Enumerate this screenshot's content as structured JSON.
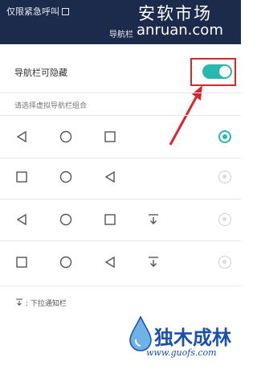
{
  "status_bar": {
    "text": "仅限紧急呼叫",
    "background": "#1c2a4c"
  },
  "page": {
    "title": "导航栏"
  },
  "watermark_top": {
    "line1": "安软市场",
    "line2": "anruan.com"
  },
  "toggle": {
    "label": "导航栏可隐藏",
    "state": "on",
    "accent": "#2ab7b0"
  },
  "highlight_color": "#d8262f",
  "combos": {
    "label": "请选择虚拟导航栏组合",
    "rows": [
      {
        "icons": [
          "back-icon",
          "home-icon",
          "recent-icon"
        ],
        "selected": true
      },
      {
        "icons": [
          "recent-icon",
          "home-icon",
          "back-icon"
        ],
        "selected": false
      },
      {
        "icons": [
          "back-icon",
          "home-icon",
          "recent-icon",
          "pull-down-icon"
        ],
        "selected": false
      },
      {
        "icons": [
          "recent-icon",
          "home-icon",
          "back-icon",
          "pull-down-icon"
        ],
        "selected": false
      }
    ]
  },
  "legend": {
    "text": ": 下拉通知栏"
  },
  "watermark_bottom": {
    "brand": "独木成林",
    "url": "www.guofs.com"
  }
}
